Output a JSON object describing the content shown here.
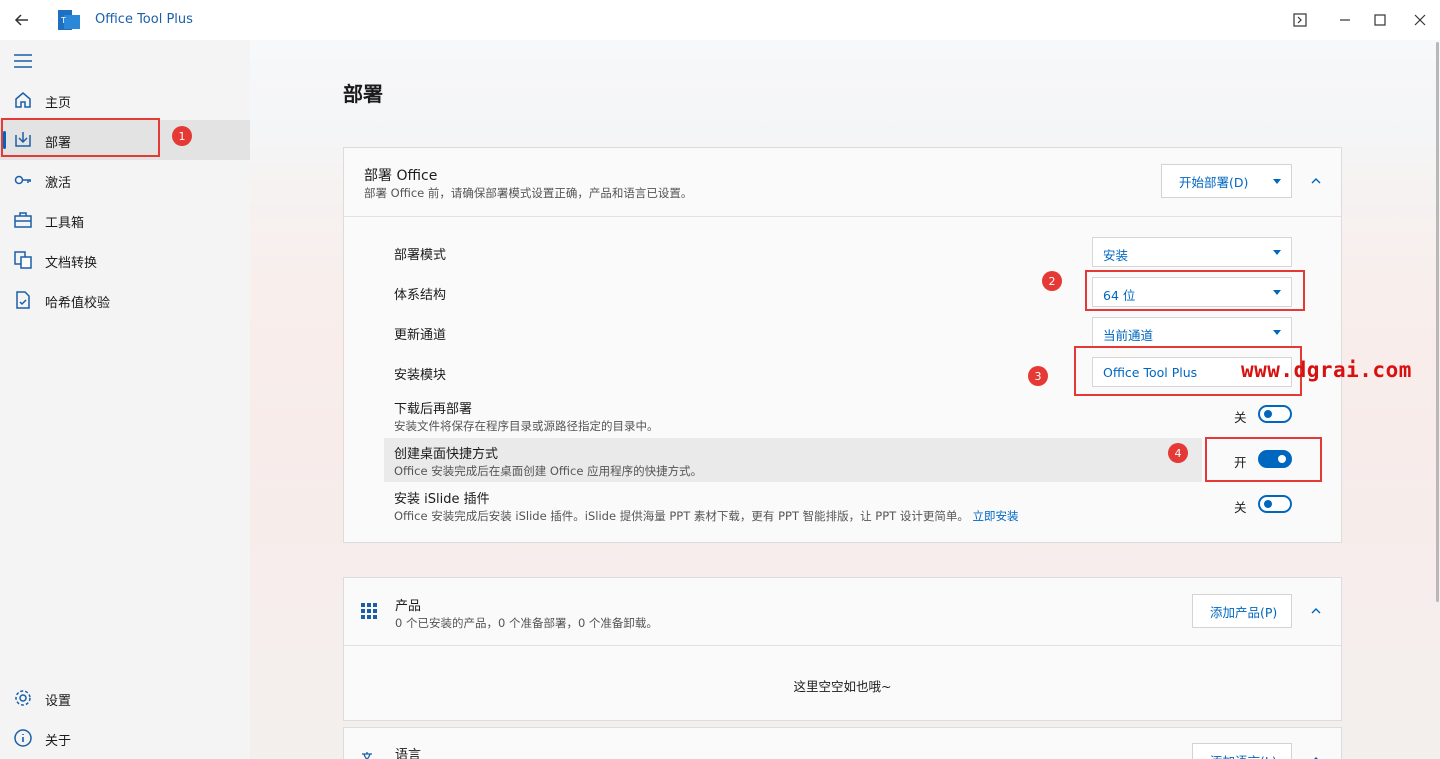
{
  "app": {
    "title": "Office Tool Plus"
  },
  "sidebar": {
    "items": [
      {
        "label": "主页",
        "icon": "home-icon"
      },
      {
        "label": "部署",
        "icon": "deploy-icon"
      },
      {
        "label": "激活",
        "icon": "key-icon"
      },
      {
        "label": "工具箱",
        "icon": "toolbox-icon"
      },
      {
        "label": "文档转换",
        "icon": "convert-icon"
      },
      {
        "label": "哈希值校验",
        "icon": "hash-check-icon"
      }
    ],
    "bottom": [
      {
        "label": "设置",
        "icon": "gear-icon"
      },
      {
        "label": "关于",
        "icon": "info-icon"
      }
    ],
    "active_index": 1
  },
  "page": {
    "title": "部署"
  },
  "deploy_card": {
    "title": "部署 Office",
    "subtitle": "部署 Office 前，请确保部署模式设置正确，产品和语言已设置。",
    "start_button": "开始部署(D)",
    "rows": {
      "mode": {
        "label": "部署模式",
        "value": "安装"
      },
      "arch": {
        "label": "体系结构",
        "value": "64 位"
      },
      "channel": {
        "label": "更新通道",
        "value": "当前通道"
      },
      "module": {
        "label": "安装模块",
        "value": "Office Tool Plus"
      },
      "download_first": {
        "label": "下载后再部署",
        "desc": "安装文件将保存在程序目录或源路径指定的目录中。",
        "state": "关",
        "on": false
      },
      "shortcut": {
        "label": "创建桌面快捷方式",
        "desc": "Office 安装完成后在桌面创建 Office 应用程序的快捷方式。",
        "state": "开",
        "on": true
      },
      "islide": {
        "label": "安装 iSlide 插件",
        "desc": "Office 安装完成后安装 iSlide 插件。iSlide 提供海量 PPT 素材下载，更有 PPT 智能排版，让 PPT 设计更简单。",
        "link": "立即安装",
        "state": "关",
        "on": false
      }
    }
  },
  "products_card": {
    "title": "产品",
    "subtitle": "0 个已安装的产品，0 个准备部署，0 个准备卸载。",
    "add_button": "添加产品(P)",
    "empty_text": "这里空空如也哦~"
  },
  "language_card": {
    "title": "语言",
    "add_button": "添加语言(L)"
  },
  "annotations": [
    "1",
    "2",
    "3",
    "4"
  ],
  "watermark": "www.dgrai.com",
  "colors": {
    "accent": "#0067c0",
    "annotation": "#e53935"
  }
}
